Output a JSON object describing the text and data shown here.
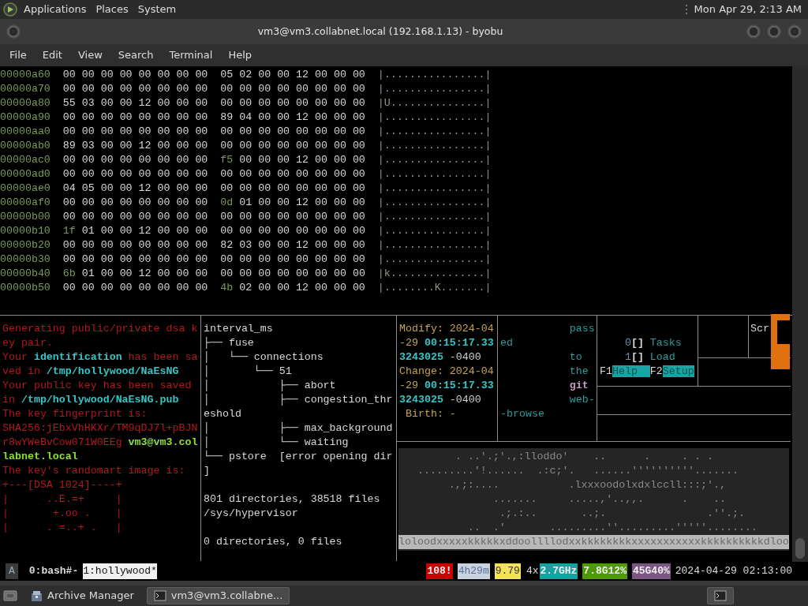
{
  "top_panel": {
    "menus": [
      "Applications",
      "Places",
      "System"
    ],
    "clock": "Mon Apr 29, 2:13 AM"
  },
  "window": {
    "title": "vm3@vm3.collabnet.local (192.168.1.13) - byobu"
  },
  "menu": [
    "File",
    "Edit",
    "View",
    "Search",
    "Terminal",
    "Help"
  ],
  "hexdump": [
    {
      "offset": "00000a60",
      "left": "00 00 00 00 00 00 00 00",
      "right": "05 02 00 00 12 00 00 00",
      "ascii": "|................|"
    },
    {
      "offset": "00000a70",
      "left": "00 00 00 00 00 00 00 00",
      "right": "00 00 00 00 00 00 00 00",
      "ascii": "|................|"
    },
    {
      "offset": "00000a80",
      "left": "55 03 00 00 12 00 00 00",
      "right": "00 00 00 00 00 00 00 00",
      "ascii": "|U...............|"
    },
    {
      "offset": "00000a90",
      "left": "00 00 00 00 00 00 00 00",
      "right": "89 04 00 00 12 00 00 00",
      "ascii": "|................|"
    },
    {
      "offset": "00000aa0",
      "left": "00 00 00 00 00 00 00 00",
      "right": "00 00 00 00 00 00 00 00",
      "ascii": "|................|"
    },
    {
      "offset": "00000ab0",
      "left": "89 03 00 00 12 00 00 00",
      "right": "00 00 00 00 00 00 00 00",
      "ascii": "|................|"
    },
    {
      "offset": "00000ac0",
      "left": "00 00 00 00 00 00 00 00",
      "right": "f5 00 00 00 12 00 00 00",
      "ascii": "|................|",
      "accent_right": true
    },
    {
      "offset": "00000ad0",
      "left": "00 00 00 00 00 00 00 00",
      "right": "00 00 00 00 00 00 00 00",
      "ascii": "|................|"
    },
    {
      "offset": "00000ae0",
      "left": "04 05 00 00 12 00 00 00",
      "right": "00 00 00 00 00 00 00 00",
      "ascii": "|................|"
    },
    {
      "offset": "00000af0",
      "left": "00 00 00 00 00 00 00 00",
      "right": "0d 01 00 00 12 00 00 00",
      "ascii": "|................|",
      "accent_right": true
    },
    {
      "offset": "00000b00",
      "left": "00 00 00 00 00 00 00 00",
      "right": "00 00 00 00 00 00 00 00",
      "ascii": "|................|"
    },
    {
      "offset": "00000b10",
      "left": "1f 01 00 00 12 00 00 00",
      "right": "00 00 00 00 00 00 00 00",
      "ascii": "|................|",
      "accent_left": true
    },
    {
      "offset": "00000b20",
      "left": "00 00 00 00 00 00 00 00",
      "right": "82 03 00 00 12 00 00 00",
      "ascii": "|................|"
    },
    {
      "offset": "00000b30",
      "left": "00 00 00 00 00 00 00 00",
      "right": "00 00 00 00 00 00 00 00",
      "ascii": "|................|"
    },
    {
      "offset": "00000b40",
      "left": "6b 01 00 00 12 00 00 00",
      "right": "00 00 00 00 00 00 00 00",
      "ascii": "|k...............|",
      "accent_left": true
    },
    {
      "offset": "00000b50",
      "left": "00 00 00 00 00 00 00 00",
      "right": "4b 02 00 00 12 00 00 00",
      "ascii": "|........K.......|",
      "accent_right": true
    }
  ],
  "keygen_pane": [
    [
      {
        "text": "Generating public/private dsa k",
        "color": "#b3191c"
      }
    ],
    [
      {
        "text": "ey pair.",
        "color": "#b3191c"
      }
    ],
    [
      {
        "text": "Your ",
        "color": "#b3191c"
      },
      {
        "text": "identification",
        "color": "#34c6c6",
        "bold": true
      },
      {
        "text": " has been sa",
        "color": "#b3191c"
      }
    ],
    [
      {
        "text": "ved in ",
        "color": "#b3191c"
      },
      {
        "text": "/tmp/hollywood/NaEsNG",
        "color": "#34c6c6",
        "bold": true
      }
    ],
    [
      {
        "text": "Your public key has been saved",
        "color": "#b3191c"
      }
    ],
    [
      {
        "text": "in ",
        "color": "#b3191c"
      },
      {
        "text": "/tmp/hollywood/NaEsNG.pub",
        "color": "#34c6c6",
        "bold": true
      }
    ],
    [
      {
        "text": "The key fingerprint is:",
        "color": "#b3191c"
      }
    ],
    [
      {
        "text": "SHA256:jEbxVhHKXr/TM9qDJ7l+pBJN",
        "color": "#b3191c"
      }
    ],
    [
      {
        "text": "r8wYWeBvCow071W0EEg ",
        "color": "#b3191c"
      },
      {
        "text": "vm3@vm3.col",
        "color": "#8ae234",
        "bold": true
      }
    ],
    [
      {
        "text": "labnet.local",
        "color": "#8ae234",
        "bold": true
      }
    ],
    [
      {
        "text": "The key's randomart image is:",
        "color": "#b3191c"
      }
    ],
    [
      {
        "text": "+---[DSA 1024]----+",
        "color": "#b3191c"
      }
    ],
    [
      {
        "text": "|      ..E.=+     |",
        "color": "#b3191c"
      }
    ],
    [
      {
        "text": "|       +.oo .    |",
        "color": "#b3191c"
      }
    ],
    [
      {
        "text": "|      . =..+ .   |",
        "color": "#b3191c"
      }
    ]
  ],
  "tree_pane": [
    {
      "text": "interval_ms"
    },
    {
      "text": "├── fuse"
    },
    {
      "text": "│   └── connections"
    },
    {
      "text": "│       └── 51"
    },
    {
      "text": "│           ├── abort"
    },
    {
      "text": "│           ├── congestion_thr"
    },
    {
      "text": "eshold"
    },
    {
      "text": "│           ├── max_background"
    },
    {
      "text": "│           └── waiting"
    },
    {
      "text": "└── pstore  [error opening dir"
    },
    {
      "text": "]"
    },
    {
      "text": "801 directories, 38518 files",
      "blank_before": true
    },
    {
      "text": "/sys/hypervisor"
    },
    {
      "text": "0 directories, 0 files",
      "blank_before": true
    }
  ],
  "stat_pane": [
    [
      {
        "text": "Modify: 2024-04",
        "color": "#c4a54a"
      }
    ],
    [
      {
        "text": "-29 ",
        "color": "#c4a54a"
      },
      {
        "text": "00:15:17.33",
        "color": "#34c6c6",
        "bold": true
      }
    ],
    [
      {
        "text": "3243025",
        "color": "#34c6c6",
        "bold": true
      },
      {
        "text": " -0400",
        "color": "#d0d0d0"
      }
    ],
    [
      {
        "text": "Change: 2024-04",
        "color": "#c4a54a"
      }
    ],
    [
      {
        "text": "-29 ",
        "color": "#c4a54a"
      },
      {
        "text": "00:15:17.33",
        "color": "#34c6c6",
        "bold": true
      }
    ],
    [
      {
        "text": "3243025",
        "color": "#34c6c6",
        "bold": true
      },
      {
        "text": " -0400",
        "color": "#d0d0d0"
      }
    ],
    [
      {
        "text": " Birth: -",
        "color": "#c4a54a"
      }
    ]
  ],
  "words_pane": [
    [
      {
        "text": "           pass",
        "color": "#2a9d9d"
      }
    ],
    [
      {
        "text": "ed",
        "color": "#2a9d9d"
      }
    ],
    [
      {
        "text": "           to",
        "color": "#2a9d9d"
      }
    ],
    [
      {
        "text": "           the",
        "color": "#2a9d9d"
      }
    ],
    [
      {
        "text": "           git",
        "color": "#c59bc5",
        "bold": true
      }
    ],
    [
      {
        "text": "           web-",
        "color": "#2a9d9d"
      }
    ],
    [
      {
        "text": "-browse",
        "color": "#2a9d9d"
      }
    ]
  ],
  "htop_pane": {
    "meters": [
      {
        "cpu": "0",
        "brackets": "[]",
        "label": "Tasks"
      },
      {
        "cpu": "1",
        "brackets": "[]",
        "label": "Load"
      }
    ],
    "keys": [
      {
        "key": "F1",
        "action": "Help  "
      },
      {
        "key": "F2",
        "action": "Setup"
      }
    ],
    "side_label": "Scr"
  },
  "ascii_art": [
    "         . ..'.;'.,:lloddo'    ..      .     . . .",
    "   .........'!......  .:c;'.   ......''''''''''.......",
    "        .,;:....           .lxxxoodolxdxlccll:::;'.,",
    "               .......     .....,'..,,.      .    ..",
    "                .;.:..       ..;.                .''.;.",
    "           ..  .'       .........''.........'''''........"
  ],
  "ascii_art_footer": "loloodxxxxxkkkkkxddoollllodxxkkkkkkkkxxxxxxxxxxxkkkkkkkkkkdloo",
  "status_bar": {
    "session": "A",
    "windows": [
      {
        "label": "0:bash#-",
        "selected": false
      },
      {
        "label": "1:hollywood*",
        "selected": true
      }
    ],
    "indicators": [
      {
        "text": "108!",
        "color": "#cc0000"
      },
      {
        "text": "4h29m",
        "color": "#c9d3e0"
      },
      {
        "text": "9.79",
        "color": "#f3e35b"
      },
      {
        "text": "4x"
      },
      {
        "text": "2.7GHz",
        "color": "#16a0a0"
      },
      {
        "text": "7.8G12%",
        "color": "#4e9a06"
      },
      {
        "text": "45G40%",
        "color": "#7d5584"
      }
    ],
    "clock": "2024-04-29 02:13:00"
  },
  "taskbar": {
    "tasks": [
      {
        "label": "Archive Manager",
        "selected": false
      },
      {
        "label": "vm3@vm3.collabne...",
        "selected": true
      }
    ]
  }
}
